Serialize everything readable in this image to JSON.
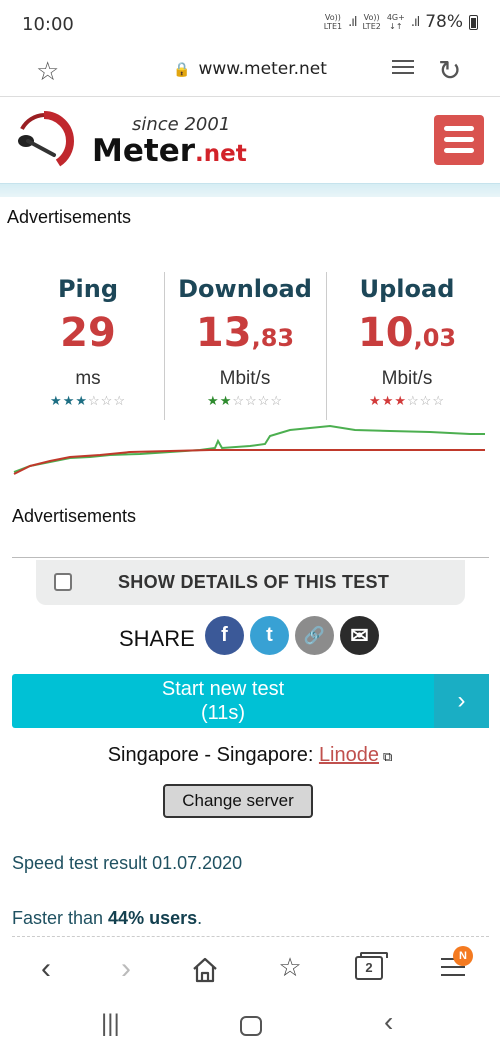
{
  "status": {
    "time": "10:00",
    "sim1": "Vo))\nLTE1",
    "sim2": "Vo))\nLTE2",
    "net": "4G+",
    "battery": "78%"
  },
  "browser": {
    "url": "www.meter.net"
  },
  "site": {
    "since": "since 2001",
    "brand": "Meter",
    "brand_tld": ".net"
  },
  "ads_label": "Advertisements",
  "results": [
    {
      "label": "Ping",
      "value": "29",
      "decimal": "",
      "unit": "ms",
      "stars_filled": 3,
      "stars_total": 6,
      "star_color": "#1d6e83"
    },
    {
      "label": "Download",
      "value": "13",
      "decimal": ",83",
      "unit": "Mbit/s",
      "stars_filled": 2,
      "stars_total": 6,
      "star_color": "#2e8b2e"
    },
    {
      "label": "Upload",
      "value": "10",
      "decimal": ",03",
      "unit": "Mbit/s",
      "stars_filled": 3,
      "stars_total": 6,
      "star_color": "#d23a3a"
    }
  ],
  "details": {
    "label": "SHOW DETAILS OF THIS TEST",
    "checked": false
  },
  "share": {
    "label": "SHARE",
    "buttons": [
      {
        "name": "facebook",
        "glyph": "f",
        "color": "#3b5998"
      },
      {
        "name": "twitter",
        "glyph": "t",
        "color": "#38a1d4"
      },
      {
        "name": "link",
        "glyph": "🔗",
        "color": "#8c8c8c"
      },
      {
        "name": "email",
        "glyph": "✉",
        "color": "#2b2b2b"
      }
    ]
  },
  "start": {
    "line1": "Start new test",
    "line2": "(11s)",
    "arrow": "›"
  },
  "server": {
    "prefix": "Singapore - Singapore: ",
    "provider": "Linode"
  },
  "change_server": "Change server",
  "result_date": "Speed test result 01.07.2020",
  "faster": {
    "prefix": "Faster than ",
    "value": "44% users",
    "suffix": "."
  },
  "bottom_nav": {
    "tabs_count": "2",
    "badge": "N"
  },
  "colors": {
    "accent": "#00c1d5",
    "brand_red": "#d2232a",
    "title_blue": "#1d4758",
    "value_red": "#c83d3d"
  }
}
